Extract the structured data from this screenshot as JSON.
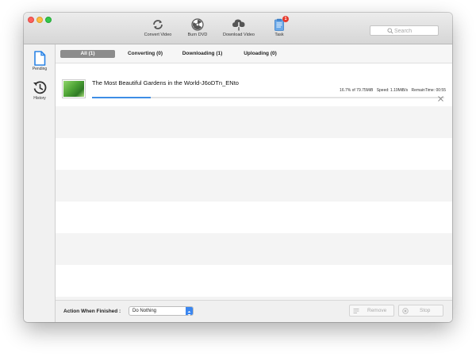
{
  "toolbar": {
    "convert_label": "Convert Video",
    "burn_label": "Burn DVD",
    "download_label": "Download Video",
    "task_label": "Task",
    "task_badge": "1"
  },
  "search": {
    "placeholder": "Search"
  },
  "sidebar": {
    "pending_label": "Pending",
    "history_label": "History"
  },
  "tabs": [
    {
      "label": "All (1)",
      "active": true
    },
    {
      "label": "Converting (0)",
      "active": false
    },
    {
      "label": "Downloading (1)",
      "active": false
    },
    {
      "label": "Uploading (0)",
      "active": false
    }
  ],
  "item": {
    "title": "The Most Beautiful Gardens in the World-J6oDTn_ENto",
    "progress_text": "16.7% of 79.75MiB",
    "speed": "Speed:  1.19MiB/s",
    "remain": "RemainTime: 00:55",
    "progress_fraction": 0.167
  },
  "footer": {
    "action_label": "Action When Finished :",
    "action_value": "Do Nothing",
    "remove_label": "Remove",
    "stop_label": "Stop"
  },
  "colors": {
    "accent": "#3e8ee5",
    "badge": "#e63b2e",
    "tab_active": "#8c8c8c"
  }
}
